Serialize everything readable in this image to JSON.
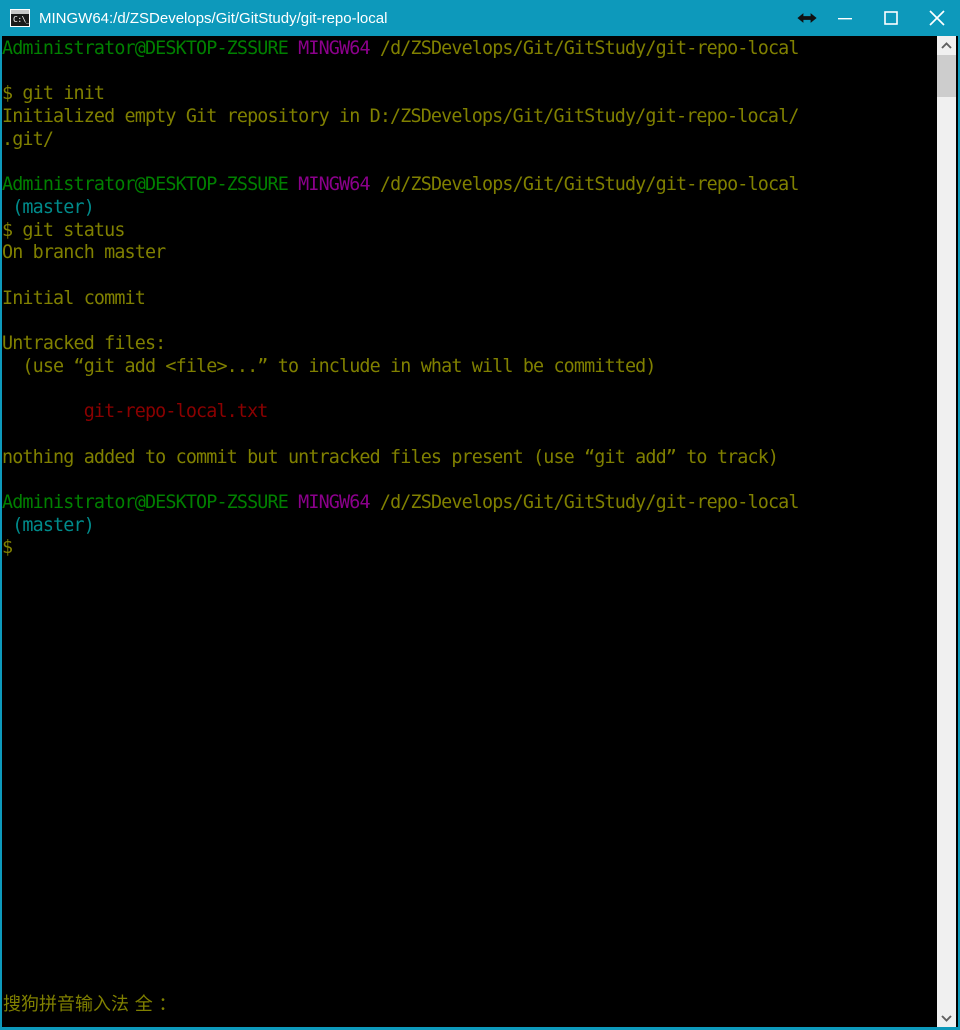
{
  "window": {
    "title": "MINGW64:/d/ZSDevelops/Git/GitStudy/git-repo-local",
    "icon_name": "console-icon",
    "icon_glyph": "C:\\_",
    "titlebar_color": "#0d99bb",
    "background_color": "#000000",
    "controls": {
      "resize_cursor": "↔",
      "minimize_label": "Minimize",
      "maximize_label": "Maximize",
      "close_label": "Close"
    }
  },
  "terminal": {
    "colors": {
      "foreground": "#808000",
      "background": "#000000",
      "user_host": "#008000",
      "shell_name": "#8b008b",
      "path": "#808000",
      "branch": "#008b8b",
      "untracked_file": "#8b0000"
    },
    "lines": [
      {
        "segments": [
          {
            "text": "Administrator@DESKTOP-ZSSURE",
            "color": "green"
          },
          {
            "text": " ",
            "color": "olive"
          },
          {
            "text": "MINGW64",
            "color": "purple"
          },
          {
            "text": " /d/ZSDevelops/Git/GitStudy/git-repo-local",
            "color": "olive"
          }
        ]
      },
      {
        "segments": [
          {
            "text": "",
            "color": "olive"
          }
        ]
      },
      {
        "segments": [
          {
            "text": "$ git init",
            "color": "olive"
          }
        ]
      },
      {
        "segments": [
          {
            "text": "Initialized empty Git repository in D:/ZSDevelops/Git/GitStudy/git-repo-local/",
            "color": "olive"
          }
        ]
      },
      {
        "segments": [
          {
            "text": ".git/",
            "color": "olive"
          }
        ]
      },
      {
        "segments": [
          {
            "text": "",
            "color": "olive"
          }
        ]
      },
      {
        "segments": [
          {
            "text": "Administrator@DESKTOP-ZSSURE",
            "color": "green"
          },
          {
            "text": " ",
            "color": "olive"
          },
          {
            "text": "MINGW64",
            "color": "purple"
          },
          {
            "text": " /d/ZSDevelops/Git/GitStudy/git-repo-local",
            "color": "olive"
          }
        ]
      },
      {
        "segments": [
          {
            "text": " (master)",
            "color": "cyan"
          }
        ]
      },
      {
        "segments": [
          {
            "text": "$ git status",
            "color": "olive"
          }
        ]
      },
      {
        "segments": [
          {
            "text": "On branch master",
            "color": "olive"
          }
        ]
      },
      {
        "segments": [
          {
            "text": "",
            "color": "olive"
          }
        ]
      },
      {
        "segments": [
          {
            "text": "Initial commit",
            "color": "olive"
          }
        ]
      },
      {
        "segments": [
          {
            "text": "",
            "color": "olive"
          }
        ]
      },
      {
        "segments": [
          {
            "text": "Untracked files:",
            "color": "olive"
          }
        ]
      },
      {
        "segments": [
          {
            "text": "  (use “git add <file>...” to include in what will be committed)",
            "color": "olive"
          }
        ]
      },
      {
        "segments": [
          {
            "text": "",
            "color": "olive"
          }
        ]
      },
      {
        "segments": [
          {
            "text": "        git-repo-local.txt",
            "color": "red"
          }
        ]
      },
      {
        "segments": [
          {
            "text": "",
            "color": "olive"
          }
        ]
      },
      {
        "segments": [
          {
            "text": "nothing added to commit but untracked files present (use “git add” to track)",
            "color": "olive"
          }
        ]
      },
      {
        "segments": [
          {
            "text": "",
            "color": "olive"
          }
        ]
      },
      {
        "segments": [
          {
            "text": "Administrator@DESKTOP-ZSSURE",
            "color": "green"
          },
          {
            "text": " ",
            "color": "olive"
          },
          {
            "text": "MINGW64",
            "color": "purple"
          },
          {
            "text": " /d/ZSDevelops/Git/GitStudy/git-repo-local",
            "color": "olive"
          }
        ]
      },
      {
        "segments": [
          {
            "text": " (master)",
            "color": "cyan"
          }
        ]
      },
      {
        "segments": [
          {
            "text": "$",
            "color": "olive"
          }
        ]
      }
    ]
  },
  "scrollbar": {
    "up_arrow": "▲",
    "down_arrow": "▼",
    "thumb_label": "scroll-thumb"
  },
  "ime_status": {
    "text": "搜狗拼音输入法 全 ："
  }
}
